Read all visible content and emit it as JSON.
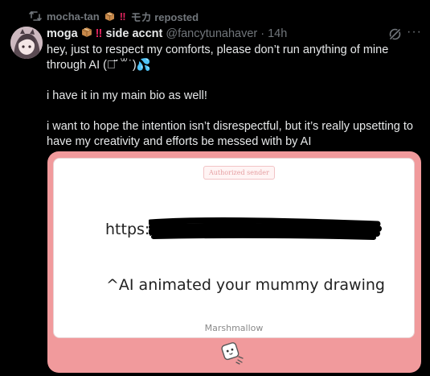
{
  "repost": {
    "reposter": "mocha-tan",
    "reposter_suffix": "モカ reposted",
    "icon": "repost-icon"
  },
  "post": {
    "display_name": "moga",
    "display_name_suffix": "side accnt",
    "handle": "@fancytunahaver",
    "separator": "·",
    "time": "14h",
    "paragraphs": [
      "hey, just to respect my comforts, please don’t run anything of mine through AI (ㅇ̆̈˙꒳˙)💦",
      "i have it in my main bio as well!",
      "i want to hope the intention isn’t disrespectful, but it’s really upsetting to have my creativity and efforts be messed with by AI"
    ],
    "accent": "#1d9bf0"
  },
  "media": {
    "badge": "Authorized sender",
    "url_prefix": "https:/",
    "message": "^AI animated your mummy drawing",
    "brand": "Marshmallow",
    "background": "#f19a9c"
  },
  "colors": {
    "background": "#000000",
    "text_primary": "#e7e9ea",
    "text_secondary": "#71767b"
  }
}
